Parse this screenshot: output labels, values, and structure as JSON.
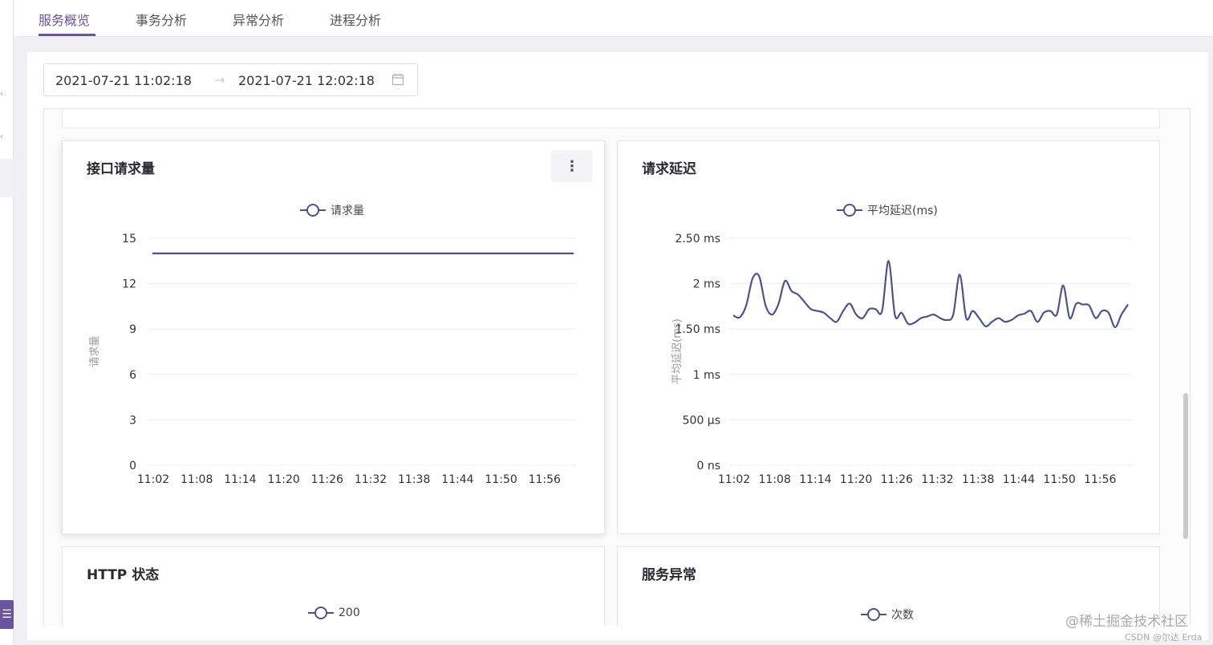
{
  "tabs": [
    {
      "label": "服务概览",
      "active": true
    },
    {
      "label": "事务分析",
      "active": false
    },
    {
      "label": "异常分析",
      "active": false
    },
    {
      "label": "进程分析",
      "active": false
    }
  ],
  "date_range": {
    "start": "2021-07-21 11:02:18",
    "arrow": "→",
    "end": "2021-07-21 12:02:18"
  },
  "colors": {
    "accent": "#6a549e",
    "series": "#4b5486",
    "grid": "#ececf0"
  },
  "cards": {
    "requests": {
      "title": "接口请求量",
      "legend": "请求量",
      "menu_icon": "more-vertical-icon"
    },
    "latency": {
      "title": "请求延迟",
      "legend": "平均延迟(ms)"
    },
    "http_status": {
      "title": "HTTP 状态",
      "legend": "200"
    },
    "exceptions": {
      "title": "服务异常",
      "legend": "次数"
    }
  },
  "chart_data": [
    {
      "type": "line",
      "title": "接口请求量",
      "ylabel": "请求量",
      "legend": "请求量",
      "y_ticks": [
        "15",
        "12",
        "9",
        "6",
        "3",
        "0"
      ],
      "ylim": [
        0,
        15
      ],
      "categories": [
        "11:02",
        "11:08",
        "11:14",
        "11:20",
        "11:26",
        "11:32",
        "11:38",
        "11:44",
        "11:50",
        "11:56"
      ],
      "series": [
        {
          "name": "请求量",
          "values": [
            14,
            14,
            14,
            14,
            14,
            14,
            14,
            14,
            14,
            14,
            14
          ]
        }
      ]
    },
    {
      "type": "line",
      "title": "请求延迟",
      "ylabel": "平均延迟(ms)",
      "legend": "平均延迟(ms)",
      "y_ticks": [
        "2.50 ms",
        "2 ms",
        "1.50 ms",
        "1 ms",
        "500 µs",
        "0 ns"
      ],
      "ylim": [
        0,
        2.5
      ],
      "categories": [
        "11:02",
        "11:08",
        "11:14",
        "11:20",
        "11:26",
        "11:32",
        "11:38",
        "11:44",
        "11:50",
        "11:56"
      ],
      "series": [
        {
          "name": "平均延迟(ms)",
          "values": [
            1.65,
            1.63,
            1.76,
            2.06,
            2.08,
            1.76,
            1.66,
            1.78,
            2.03,
            1.92,
            1.88,
            1.8,
            1.72,
            1.7,
            1.68,
            1.62,
            1.58,
            1.7,
            1.78,
            1.66,
            1.62,
            1.72,
            1.72,
            1.7,
            2.25,
            1.65,
            1.68,
            1.56,
            1.57,
            1.62,
            1.64,
            1.66,
            1.62,
            1.6,
            1.66,
            2.1,
            1.62,
            1.7,
            1.62,
            1.53,
            1.58,
            1.62,
            1.58,
            1.6,
            1.65,
            1.67,
            1.7,
            1.58,
            1.68,
            1.7,
            1.66,
            1.98,
            1.62,
            1.78,
            1.77,
            1.76,
            1.62,
            1.7,
            1.68,
            1.52,
            1.66,
            1.77
          ]
        }
      ]
    }
  ],
  "watermark": {
    "line1": "@稀土掘金技术社区",
    "line2": "CSDN @尔达 Erda"
  }
}
